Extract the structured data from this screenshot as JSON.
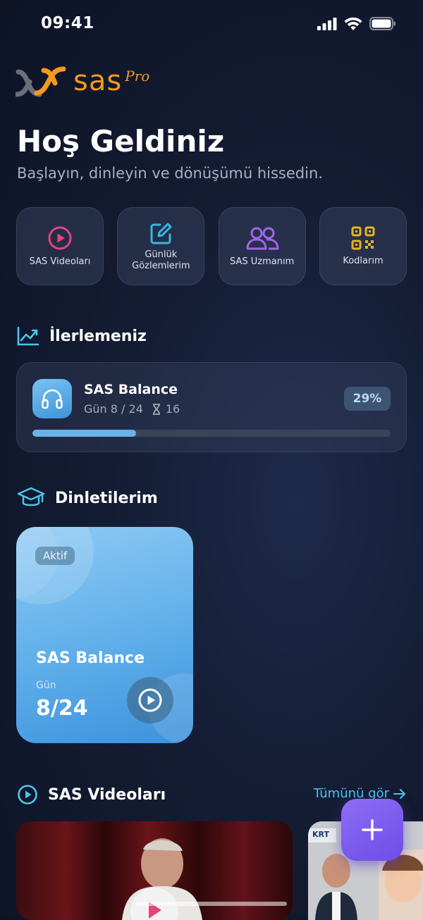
{
  "status_bar": {
    "time": "09:41"
  },
  "brand": {
    "name": "sas",
    "suffix": "Pro",
    "color": "#f39a1d"
  },
  "welcome": {
    "title": "Hoş Geldiniz",
    "subtitle": "Başlayın, dinleyin ve dönüşümü hissedin."
  },
  "quick_actions": [
    {
      "label": "SAS Videoları",
      "icon": "play-circle-icon",
      "color": "#e2457f"
    },
    {
      "label": "Günlük Gözlemlerim",
      "icon": "edit-square-icon",
      "color": "#35b8e6"
    },
    {
      "label": "SAS Uzmanım",
      "icon": "users-icon",
      "color": "#a066e8"
    },
    {
      "label": "Kodlarım",
      "icon": "qr-code-icon",
      "color": "#e8b51f"
    }
  ],
  "progress_section": {
    "title": "İlerlemeniz",
    "card": {
      "title": "SAS Balance",
      "day_text": "Gün 8 / 24",
      "hourglass_count": "16",
      "percent_label": "29%",
      "progress": 0.29
    }
  },
  "listening_section": {
    "title": "Dinletilerim",
    "card": {
      "badge": "Aktif",
      "title": "SAS Balance",
      "day_label": "Gün",
      "day_value": "8/24"
    }
  },
  "videos_section": {
    "title": "SAS Videoları",
    "see_all": "Tümünü gör",
    "second_thumb_logo": "KRT"
  },
  "colors": {
    "accent": "#48c6ec",
    "fab": "#7a5af0"
  }
}
